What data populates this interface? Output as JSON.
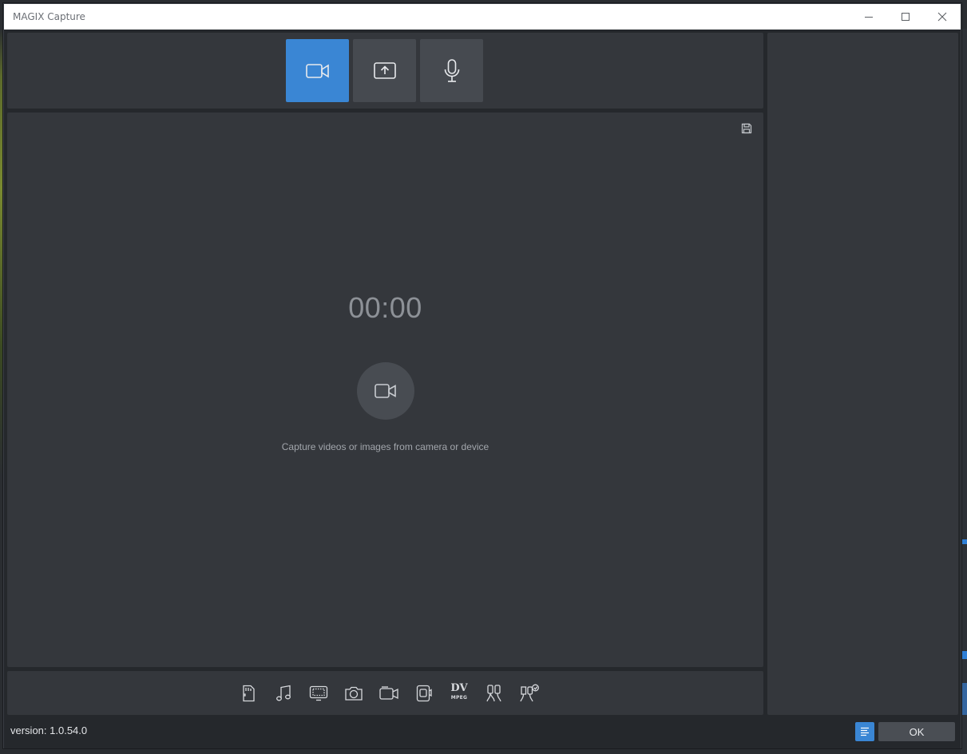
{
  "window": {
    "title": "MAGIX Capture",
    "controls": [
      "minimize-icon",
      "maximize-icon",
      "close-icon"
    ]
  },
  "modes": [
    {
      "name": "camera-capture",
      "icon": "video-camera-icon",
      "active": true
    },
    {
      "name": "screen-capture",
      "icon": "screen-upload-icon",
      "active": false
    },
    {
      "name": "audio-capture",
      "icon": "microphone-icon",
      "active": false
    }
  ],
  "preview": {
    "timer": "00:00",
    "hint": "Capture videos or images from camera or device",
    "save_icon": "floppy-disk-icon"
  },
  "devices": {
    "icons": [
      "sd-card-icon",
      "music-note-icon",
      "tv-icon",
      "photo-camera-icon",
      "camcorder-icon",
      "webcam-icon",
      "dv-mpeg-icon",
      "analog-cables-icon",
      "analog-cables-refresh-icon"
    ],
    "dv_label": "DV",
    "mpeg_label": "MPEG"
  },
  "footer": {
    "version": "version: 1.0.54.0",
    "ok_label": "OK",
    "log_icon": "log-lines-icon"
  },
  "colors": {
    "accent": "#3a86d4",
    "panel": "#34373c",
    "background": "#25282c"
  }
}
